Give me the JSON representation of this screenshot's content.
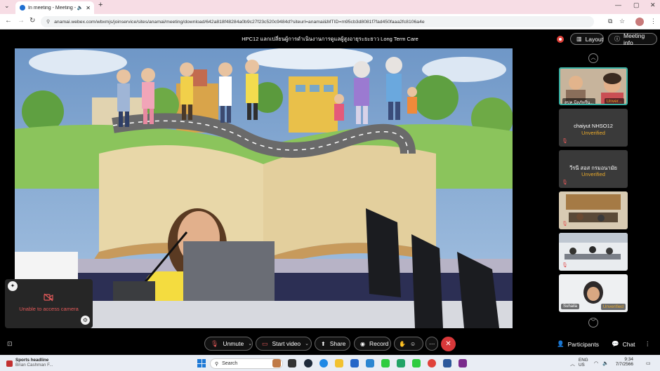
{
  "browser": {
    "tab_title": "In meeting - Meeting - Web",
    "url": "anamai.webex.com/wbxmjs/joinservice/sites/anamai/meeting/download/642a818f48284a0b9c27f23c520c9484d?siteurl=anamai&MTID=m95cb3d8081f7fad450faaa2fc8106a4e"
  },
  "meeting": {
    "title": "HPC12 แลกเปลี่ยนผู้การดำเนินงานการดูแลผู้สูงอายุระยะยาว Long Term Care",
    "layout_label": "Layout",
    "info_label": "Meeting info"
  },
  "self_view": {
    "message": "Unable to access camera"
  },
  "participants": [
    {
      "name": "สปค.นีลภัทรีน...",
      "status": "Unver..."
    },
    {
      "name": "chaiyut NHSO12",
      "status": "Unverified"
    },
    {
      "name": "วีรนี สอส กรมอนามัย",
      "status": "Unverified"
    },
    {
      "name": "",
      "status": ""
    },
    {
      "name": "",
      "status": ""
    },
    {
      "name": "Suhaila",
      "status": "Unverified"
    }
  ],
  "controls": {
    "unmute": "Unmute",
    "start_video": "Start video",
    "share": "Share",
    "record": "Record",
    "participants": "Participants",
    "chat": "Chat"
  },
  "taskbar": {
    "news_title": "Sports headline",
    "news_sub": "Brian Cashman F...",
    "search_placeholder": "Search",
    "lang": "ENG",
    "region": "US",
    "time": "9:34",
    "date": "7/7/2566"
  },
  "colors": {
    "accent_red": "#e05959",
    "unverified": "#e8a92b",
    "end_call": "#d8383a"
  }
}
